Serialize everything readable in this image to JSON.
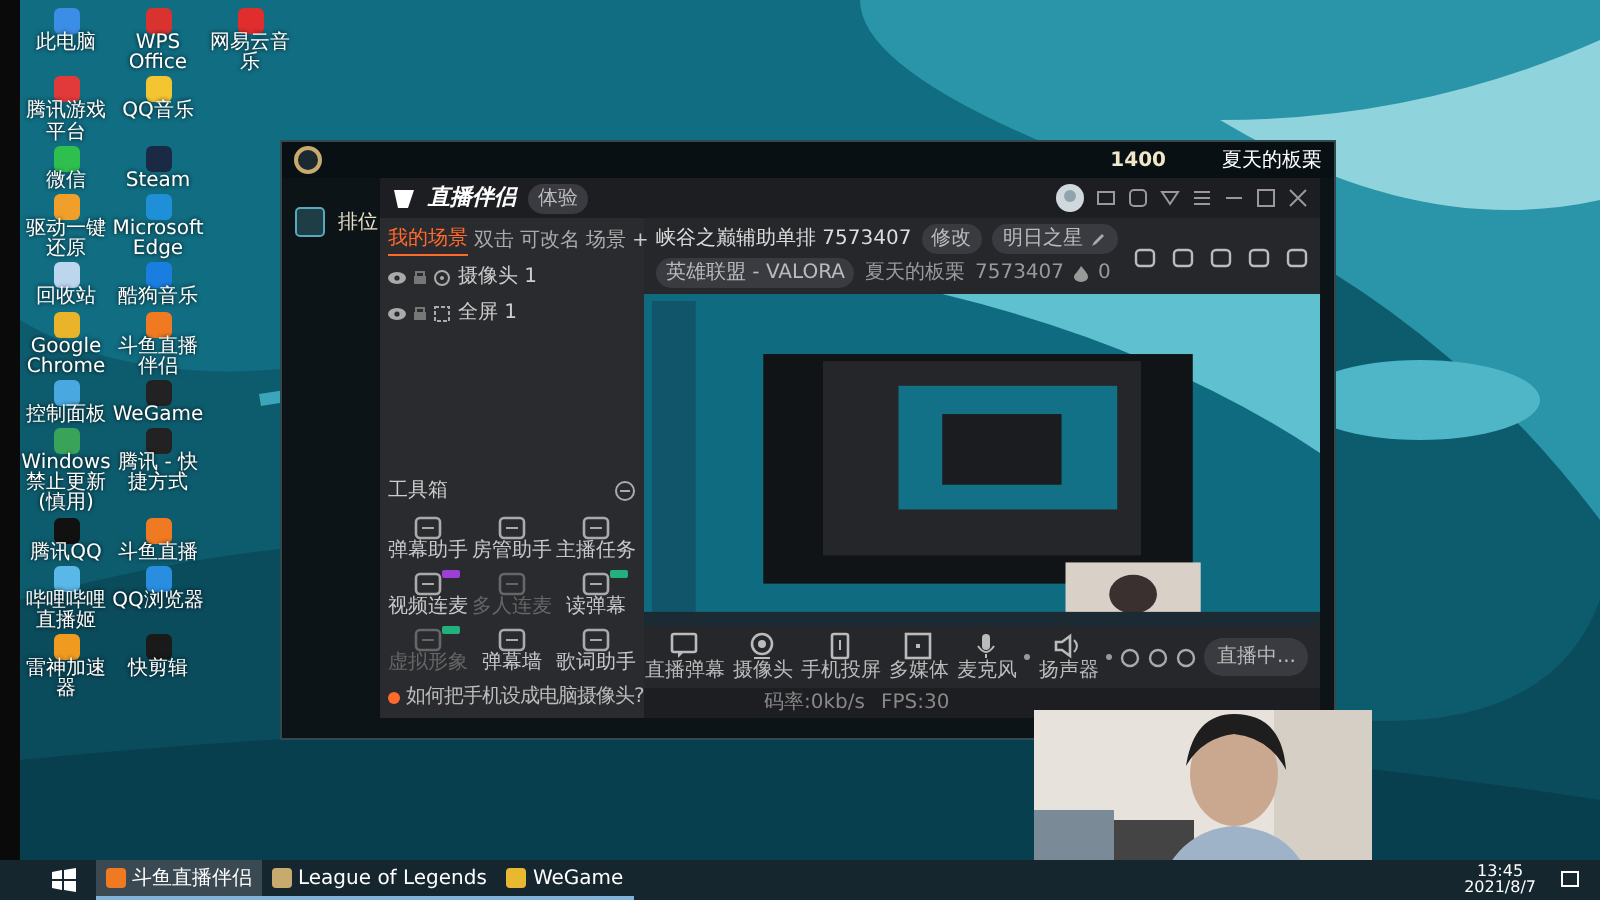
{
  "desktop_rows": [
    [
      {
        "label": "此电脑",
        "color": "#3a8ee6"
      },
      {
        "label": "WPS Office",
        "color": "#d8332f"
      },
      {
        "label": "网易云音乐",
        "color": "#e02d2d"
      }
    ],
    [
      {
        "label": "腾讯游戏平台",
        "color": "#e23a3a"
      },
      {
        "label": "QQ音乐",
        "color": "#f2c531"
      }
    ],
    [
      {
        "label": "微信",
        "color": "#2fbf4f"
      },
      {
        "label": "Steam",
        "color": "#1b2a44"
      }
    ],
    [
      {
        "label": "驱动一键还原",
        "color": "#f0a02a"
      },
      {
        "label": "Microsoft Edge",
        "color": "#1f8fd8"
      }
    ],
    [
      {
        "label": "回收站",
        "color": "#bcd6ee"
      },
      {
        "label": "酷狗音乐",
        "color": "#1a7ee0"
      }
    ],
    [
      {
        "label": "Google Chrome",
        "color": "#e9b32a"
      },
      {
        "label": "斗鱼直播伴侣",
        "color": "#f07a22"
      }
    ],
    [
      {
        "label": "控制面板",
        "color": "#4aa8e0"
      },
      {
        "label": "WeGame",
        "color": "#222222"
      }
    ],
    [
      {
        "label": "Windows禁止更新(慎用)",
        "color": "#3aa35a"
      },
      {
        "label": "腾讯 - 快捷方式",
        "color": "#222222"
      }
    ],
    [
      {
        "label": "腾讯QQ",
        "color": "#111111"
      },
      {
        "label": "斗鱼直播",
        "color": "#f07a22"
      }
    ],
    [
      {
        "label": "哔哩哔哩直播姬",
        "color": "#5ab8e8"
      },
      {
        "label": "QQ浏览器",
        "color": "#2a8ee0"
      }
    ],
    [
      {
        "label": "雷神加速器",
        "color": "#f09a20"
      },
      {
        "label": "快剪辑",
        "color": "#1a1a1a"
      }
    ]
  ],
  "game_client": {
    "tab": "排位",
    "currency": "1400",
    "summoner": "夏天的板栗"
  },
  "live_app": {
    "title": "直播伴侣",
    "edition_badge": "体验",
    "scene_tabs": [
      {
        "label": "我的场景",
        "selected": true
      },
      {
        "label": "双击",
        "selected": false
      },
      {
        "label": "可改名",
        "selected": false
      },
      {
        "label": "场景",
        "selected": false
      }
    ],
    "add_scene": "+",
    "sources": [
      {
        "label": "摄像头 1",
        "kind": "camera"
      },
      {
        "label": "全屏 1",
        "kind": "screen"
      }
    ],
    "toolbox_title": "工具箱",
    "tools": [
      {
        "label": "弹幕助手",
        "disabled": false
      },
      {
        "label": "房管助手",
        "disabled": false
      },
      {
        "label": "主播任务",
        "disabled": false
      },
      {
        "label": "视频连麦",
        "disabled": false,
        "color": "#9b3fd6"
      },
      {
        "label": "多人连麦",
        "disabled": true
      },
      {
        "label": "读弹幕",
        "disabled": false,
        "color": "#22b07d"
      },
      {
        "label": "虚拟形象",
        "disabled": true,
        "color": "#22b07d"
      },
      {
        "label": "弹幕墙",
        "disabled": false
      },
      {
        "label": "歌词助手",
        "disabled": false
      }
    ],
    "tip": "如何把手机设成电脑摄像头?",
    "stream_title": "峡谷之巅辅助单排 7573407",
    "edit_button": "修改",
    "tag_field": "明日之星",
    "category": "英雄联盟 - VALORA",
    "streamer": "夏天的板栗",
    "room_id": "7573407",
    "heat": "0",
    "controls": [
      {
        "label": "直播弹幕",
        "kind": "danmu"
      },
      {
        "label": "摄像头",
        "kind": "camera"
      },
      {
        "label": "手机投屏",
        "kind": "phone"
      },
      {
        "label": "多媒体",
        "kind": "media"
      },
      {
        "label": "麦克风",
        "kind": "mic"
      },
      {
        "label": "扬声器",
        "kind": "speaker"
      }
    ],
    "start_button": "直播中...",
    "status": [
      "码率:0kb/s",
      "FPS:30"
    ]
  },
  "taskbar": {
    "items": [
      {
        "label": "斗鱼直播伴侣",
        "selected": true
      },
      {
        "label": "League of Legends",
        "selected": false
      },
      {
        "label": "WeGame",
        "selected": false
      }
    ],
    "time": "13:45",
    "date": "2021/8/7"
  }
}
